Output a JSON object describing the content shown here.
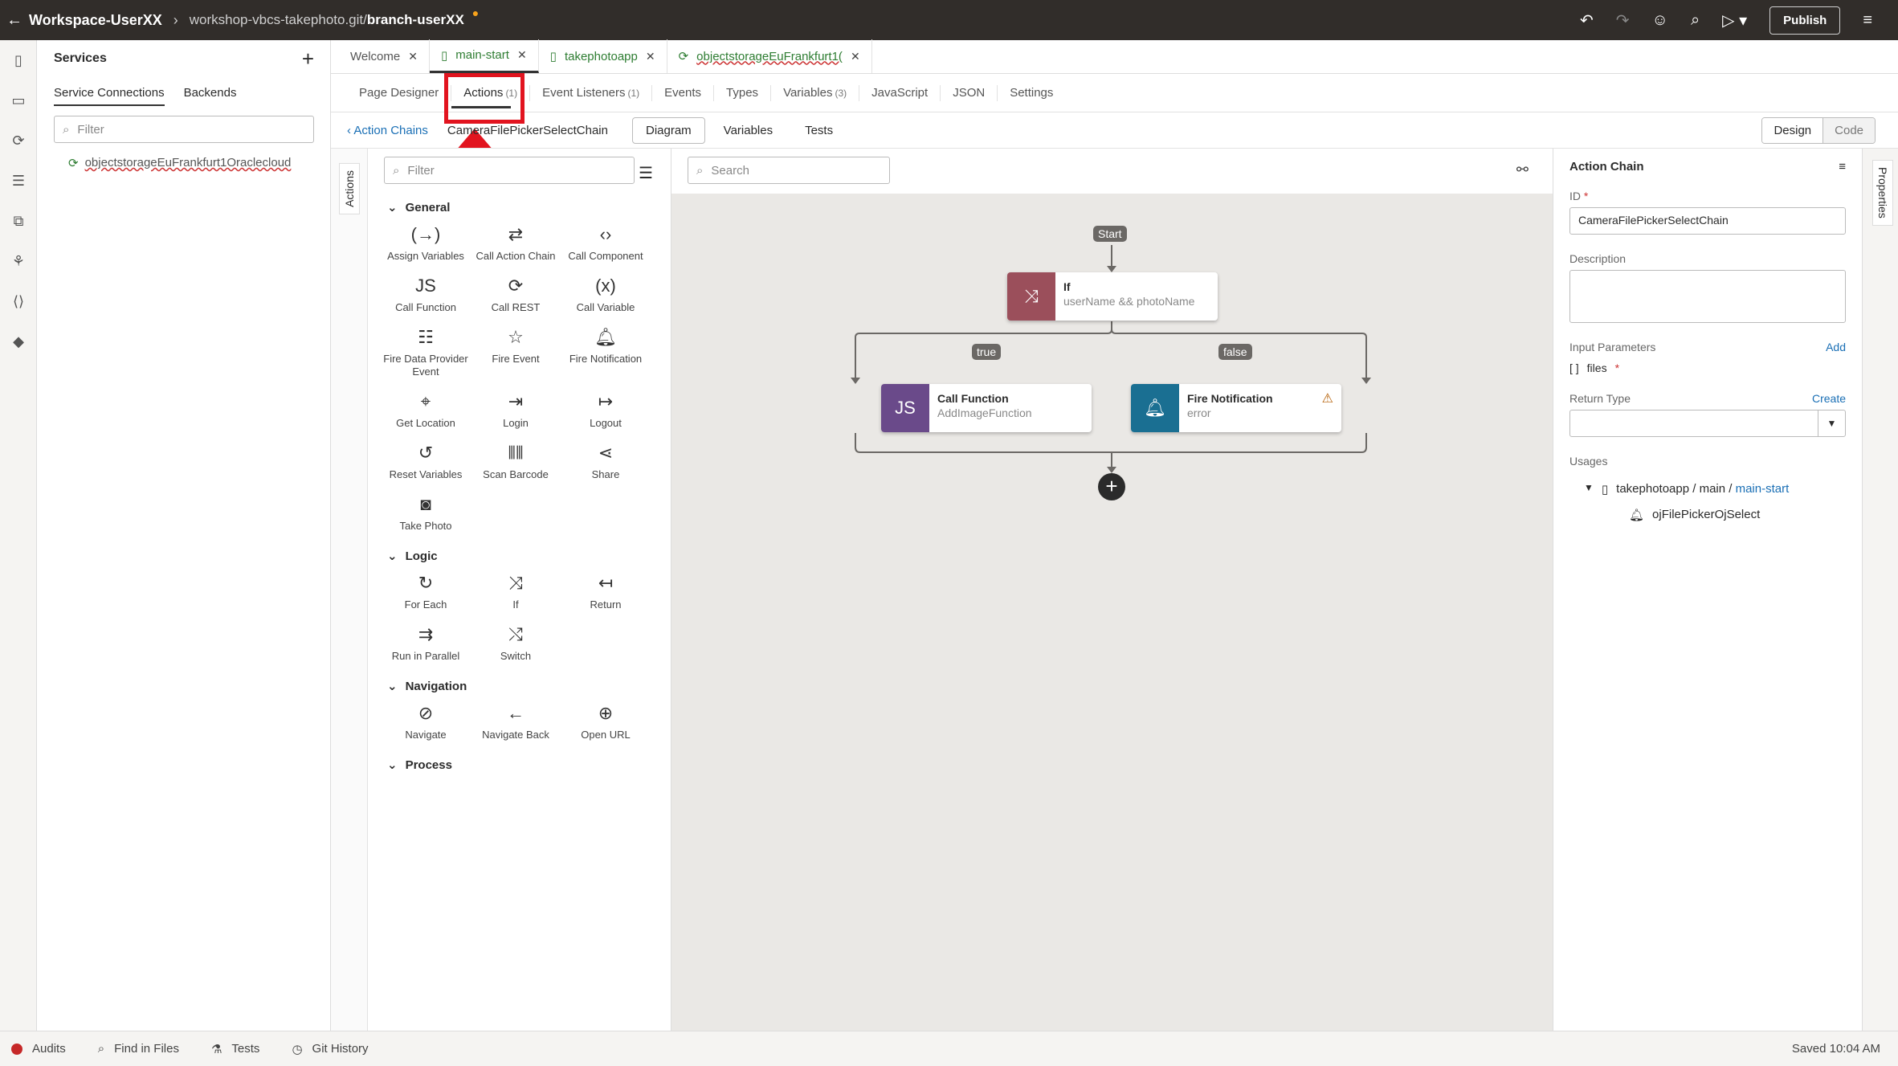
{
  "topbar": {
    "workspace": "Workspace-UserXX",
    "repo": "workshop-vbcs-takephoto.git/",
    "branch": "branch-userXX",
    "publish": "Publish"
  },
  "services": {
    "title": "Services",
    "tabs": [
      "Service Connections",
      "Backends"
    ],
    "filter_placeholder": "Filter",
    "item": "objectstorageEuFrankfurt1Oraclecloud"
  },
  "filetabs": [
    {
      "label": "Welcome"
    },
    {
      "label": "main-start"
    },
    {
      "label": "takephotoapp"
    },
    {
      "label": "objectstorageEuFrankfurt1("
    }
  ],
  "designer_tabs": [
    {
      "label": "Page Designer",
      "count": ""
    },
    {
      "label": "Actions",
      "count": "(1)"
    },
    {
      "label": "Event Listeners",
      "count": "(1)"
    },
    {
      "label": "Events",
      "count": ""
    },
    {
      "label": "Types",
      "count": ""
    },
    {
      "label": "Variables",
      "count": "(3)"
    },
    {
      "label": "JavaScript",
      "count": ""
    },
    {
      "label": "JSON",
      "count": ""
    },
    {
      "label": "Settings",
      "count": ""
    }
  ],
  "chainbar": {
    "back": "Action Chains",
    "name": "CameraFilePickerSelectChain",
    "segments": [
      "Diagram",
      "Variables",
      "Tests"
    ],
    "design": "Design",
    "code": "Code"
  },
  "side_actions_label": "Actions",
  "palette": {
    "filter_placeholder": "Filter",
    "general_title": "General",
    "general": [
      "Assign Variables",
      "Call Action Chain",
      "Call Component",
      "Call Function",
      "Call REST",
      "Call Variable",
      "Fire Data Provider Event",
      "Fire Event",
      "Fire Notification",
      "Get Location",
      "Login",
      "Logout",
      "Reset Variables",
      "Scan Barcode",
      "Share",
      "Take Photo"
    ],
    "logic_title": "Logic",
    "logic": [
      "For Each",
      "If",
      "Return",
      "Run in Parallel",
      "Switch"
    ],
    "navigation_title": "Navigation",
    "navigation": [
      "Navigate",
      "Navigate Back",
      "Open URL"
    ],
    "process_title": "Process"
  },
  "canvas": {
    "search_placeholder": "Search",
    "start": "Start",
    "if_title": "If",
    "if_sub": "userName && photoName",
    "true_label": "true",
    "false_label": "false",
    "call_title": "Call Function",
    "call_sub": "AddImageFunction",
    "fire_title": "Fire Notification",
    "fire_sub": "error",
    "colors": {
      "if": "#9b4f5b",
      "call": "#6a4a8a",
      "fire": "#1a6f92"
    }
  },
  "props": {
    "title": "Action Chain",
    "id_label": "ID",
    "id_value": "CameraFilePickerSelectChain",
    "desc_label": "Description",
    "input_label": "Input Parameters",
    "add": "Add",
    "param": "files",
    "return_label": "Return Type",
    "create": "Create",
    "usages_label": "Usages",
    "usage_path": "takephotoapp / main / ",
    "usage_link": "main-start",
    "usage_event": "ojFilePickerOjSelect",
    "side_label": "Properties"
  },
  "status": {
    "audits": "Audits",
    "find": "Find in Files",
    "tests": "Tests",
    "git": "Git History",
    "saved": "Saved 10:04 AM"
  }
}
